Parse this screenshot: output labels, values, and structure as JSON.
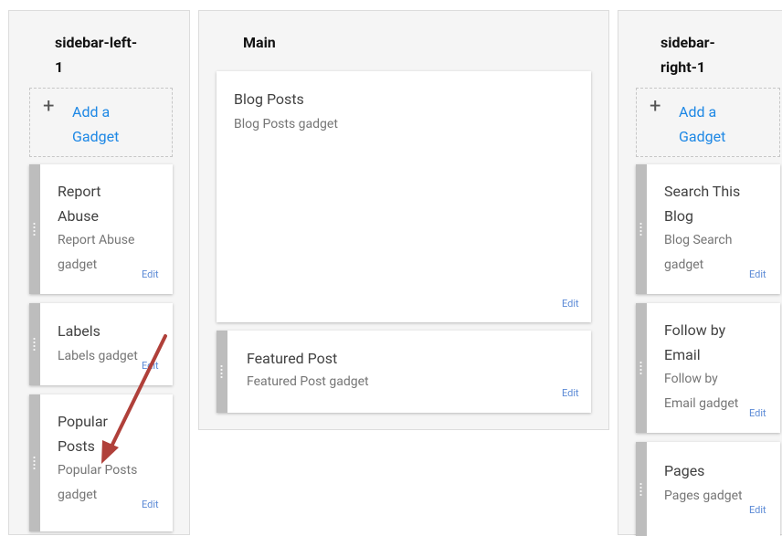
{
  "columns": {
    "left": {
      "title": "sidebar-left-1",
      "title_line1": "sidebar-left-",
      "title_line2": "1"
    },
    "main": {
      "title": "Main"
    },
    "right": {
      "title": "sidebar-right-1",
      "title_line1": "sidebar-",
      "title_line2": "right-1"
    }
  },
  "add_gadget": {
    "label_line1": "Add a",
    "label_line2": "Gadget",
    "plus": "+"
  },
  "edit_label": "Edit",
  "gadgets": {
    "report_abuse": {
      "title_line1": "Report",
      "title_line2": "Abuse",
      "desc_line1": "Report Abuse",
      "desc_line2": "gadget"
    },
    "labels": {
      "title": "Labels",
      "desc": "Labels gadget"
    },
    "popular_posts": {
      "title_line1": "Popular",
      "title_line2": "Posts",
      "desc_line1": "Popular Posts",
      "desc_line2": "gadget"
    },
    "blog_posts": {
      "title": "Blog Posts",
      "desc": "Blog Posts gadget"
    },
    "featured_post": {
      "title": "Featured Post",
      "desc": "Featured Post gadget"
    },
    "search": {
      "title_line1": "Search This",
      "title_line2": "Blog",
      "desc_line1": "Blog Search",
      "desc_line2": "gadget"
    },
    "follow_email": {
      "title_line1": "Follow by",
      "title_line2": "Email",
      "desc_line1": "Follow by",
      "desc_line2": "Email gadget"
    },
    "pages": {
      "title": "Pages",
      "desc": "Pages gadget"
    }
  },
  "colors": {
    "accent": "#1e88e5",
    "edit": "#5b8ad6",
    "annotation_arrow": "#b0403a"
  }
}
